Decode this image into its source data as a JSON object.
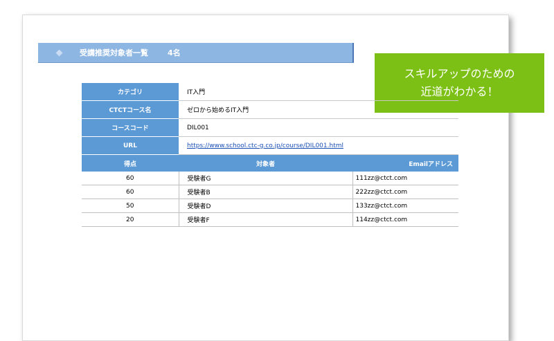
{
  "banner": {
    "title": "受講推奨対象者一覧",
    "count": "4名"
  },
  "callout": {
    "line1": "スキルアップのための",
    "line2": "近道がわかる！"
  },
  "info": [
    {
      "label": "カテゴリ",
      "value": "IT入門"
    },
    {
      "label": "CTCTコース名",
      "value": "ゼロから始めるIT入門"
    },
    {
      "label": "コースコード",
      "value": "DIL001"
    },
    {
      "label": "URL",
      "value": "https://www.school.ctc-g.co.jp/course/DIL001.html"
    }
  ],
  "columns": [
    "得点",
    "対象者",
    "Emailアドレス"
  ],
  "rows": [
    {
      "score": "60",
      "name": "受験者G",
      "email": "111zz@ctct.com"
    },
    {
      "score": "60",
      "name": "受験者B",
      "email": "222zz@ctct.com"
    },
    {
      "score": "50",
      "name": "受験者D",
      "email": "133zz@ctct.com"
    },
    {
      "score": "20",
      "name": "受験者F",
      "email": "114zz@ctct.com"
    }
  ],
  "colors": {
    "header_blue": "#5c9ad5",
    "banner_blue": "#8eb6e3",
    "callout_green": "#7dc015"
  }
}
